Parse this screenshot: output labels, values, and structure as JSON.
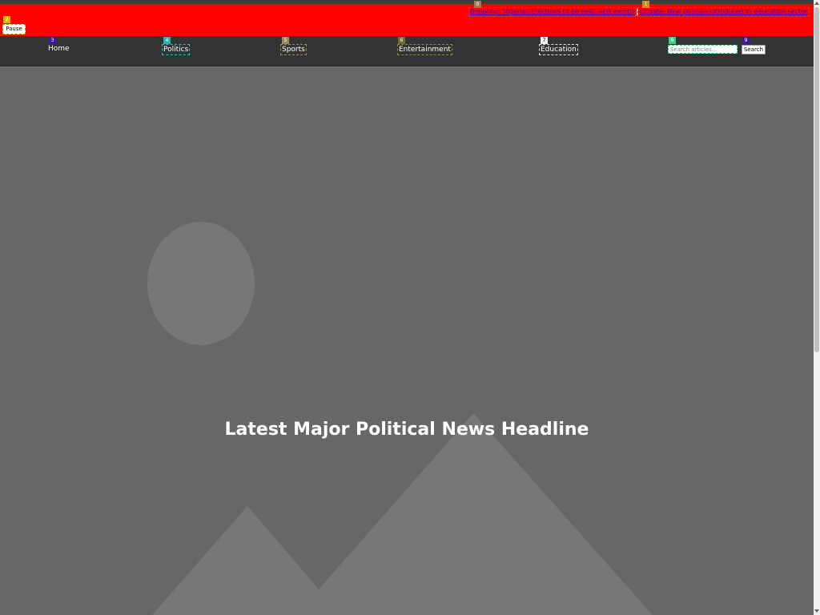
{
  "ticker": {
    "headlines": [
      "Breaking: Nigerian Elections to be held next month",
      "Update: New policies introduced in education sector"
    ],
    "pause_label": "Pause"
  },
  "nav": {
    "items": [
      {
        "label": "Home",
        "badge": "3"
      },
      {
        "label": "Politics",
        "badge": "4"
      },
      {
        "label": "Sports",
        "badge": "5"
      },
      {
        "label": "Entertainment",
        "badge": "6"
      },
      {
        "label": "Education",
        "badge": "7"
      }
    ]
  },
  "search": {
    "placeholder": "Search articles...",
    "value": "",
    "button_label": "Search",
    "input_badge": "8",
    "button_badge": "9"
  },
  "badges": {
    "ticker_link_1": "0",
    "ticker_link_2": "1",
    "pause": "2"
  },
  "hero": {
    "title": "Latest Major Political News Headline",
    "image_icon": "image-placeholder-icon"
  },
  "colors": {
    "ticker_bg": "#ff0000",
    "nav_bg": "#333333",
    "hero_bg": "#676767",
    "link": "#4b00cc"
  }
}
